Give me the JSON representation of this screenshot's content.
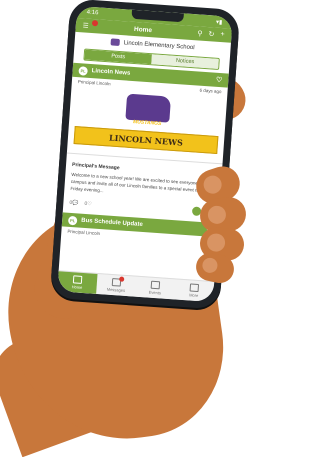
{
  "status": {
    "time": "4:16"
  },
  "topbar": {
    "title": "Home"
  },
  "school": {
    "name": "Lincoln Elementary School"
  },
  "segments": {
    "posts": "Posts",
    "notices": "Notices"
  },
  "post1": {
    "avatar": "PL",
    "title": "Lincoln News",
    "author": "Principal Lincoln",
    "time": "6 days ago",
    "mascot": "MUSTANGS",
    "banner": "LINCOLN NEWS",
    "message_title": "Principal's Message",
    "message_body": "Welcome to a new school year! We are excited to see everyone back on campus and invite all of our Lincoln families to a special event next Friday evening...",
    "comments": "0",
    "likes": "0"
  },
  "post2": {
    "avatar": "PL",
    "title": "Bus Schedule Update",
    "author": "Principal Lincoln"
  },
  "tabs": [
    {
      "label": "Home"
    },
    {
      "label": "Messages"
    },
    {
      "label": "Events"
    },
    {
      "label": "More"
    }
  ],
  "colors": {
    "accent": "#7aa83f",
    "badge": "#d9372e",
    "banner": "#f2c21b",
    "mascot": "#5b3a8e",
    "skin": "#c8773b"
  }
}
